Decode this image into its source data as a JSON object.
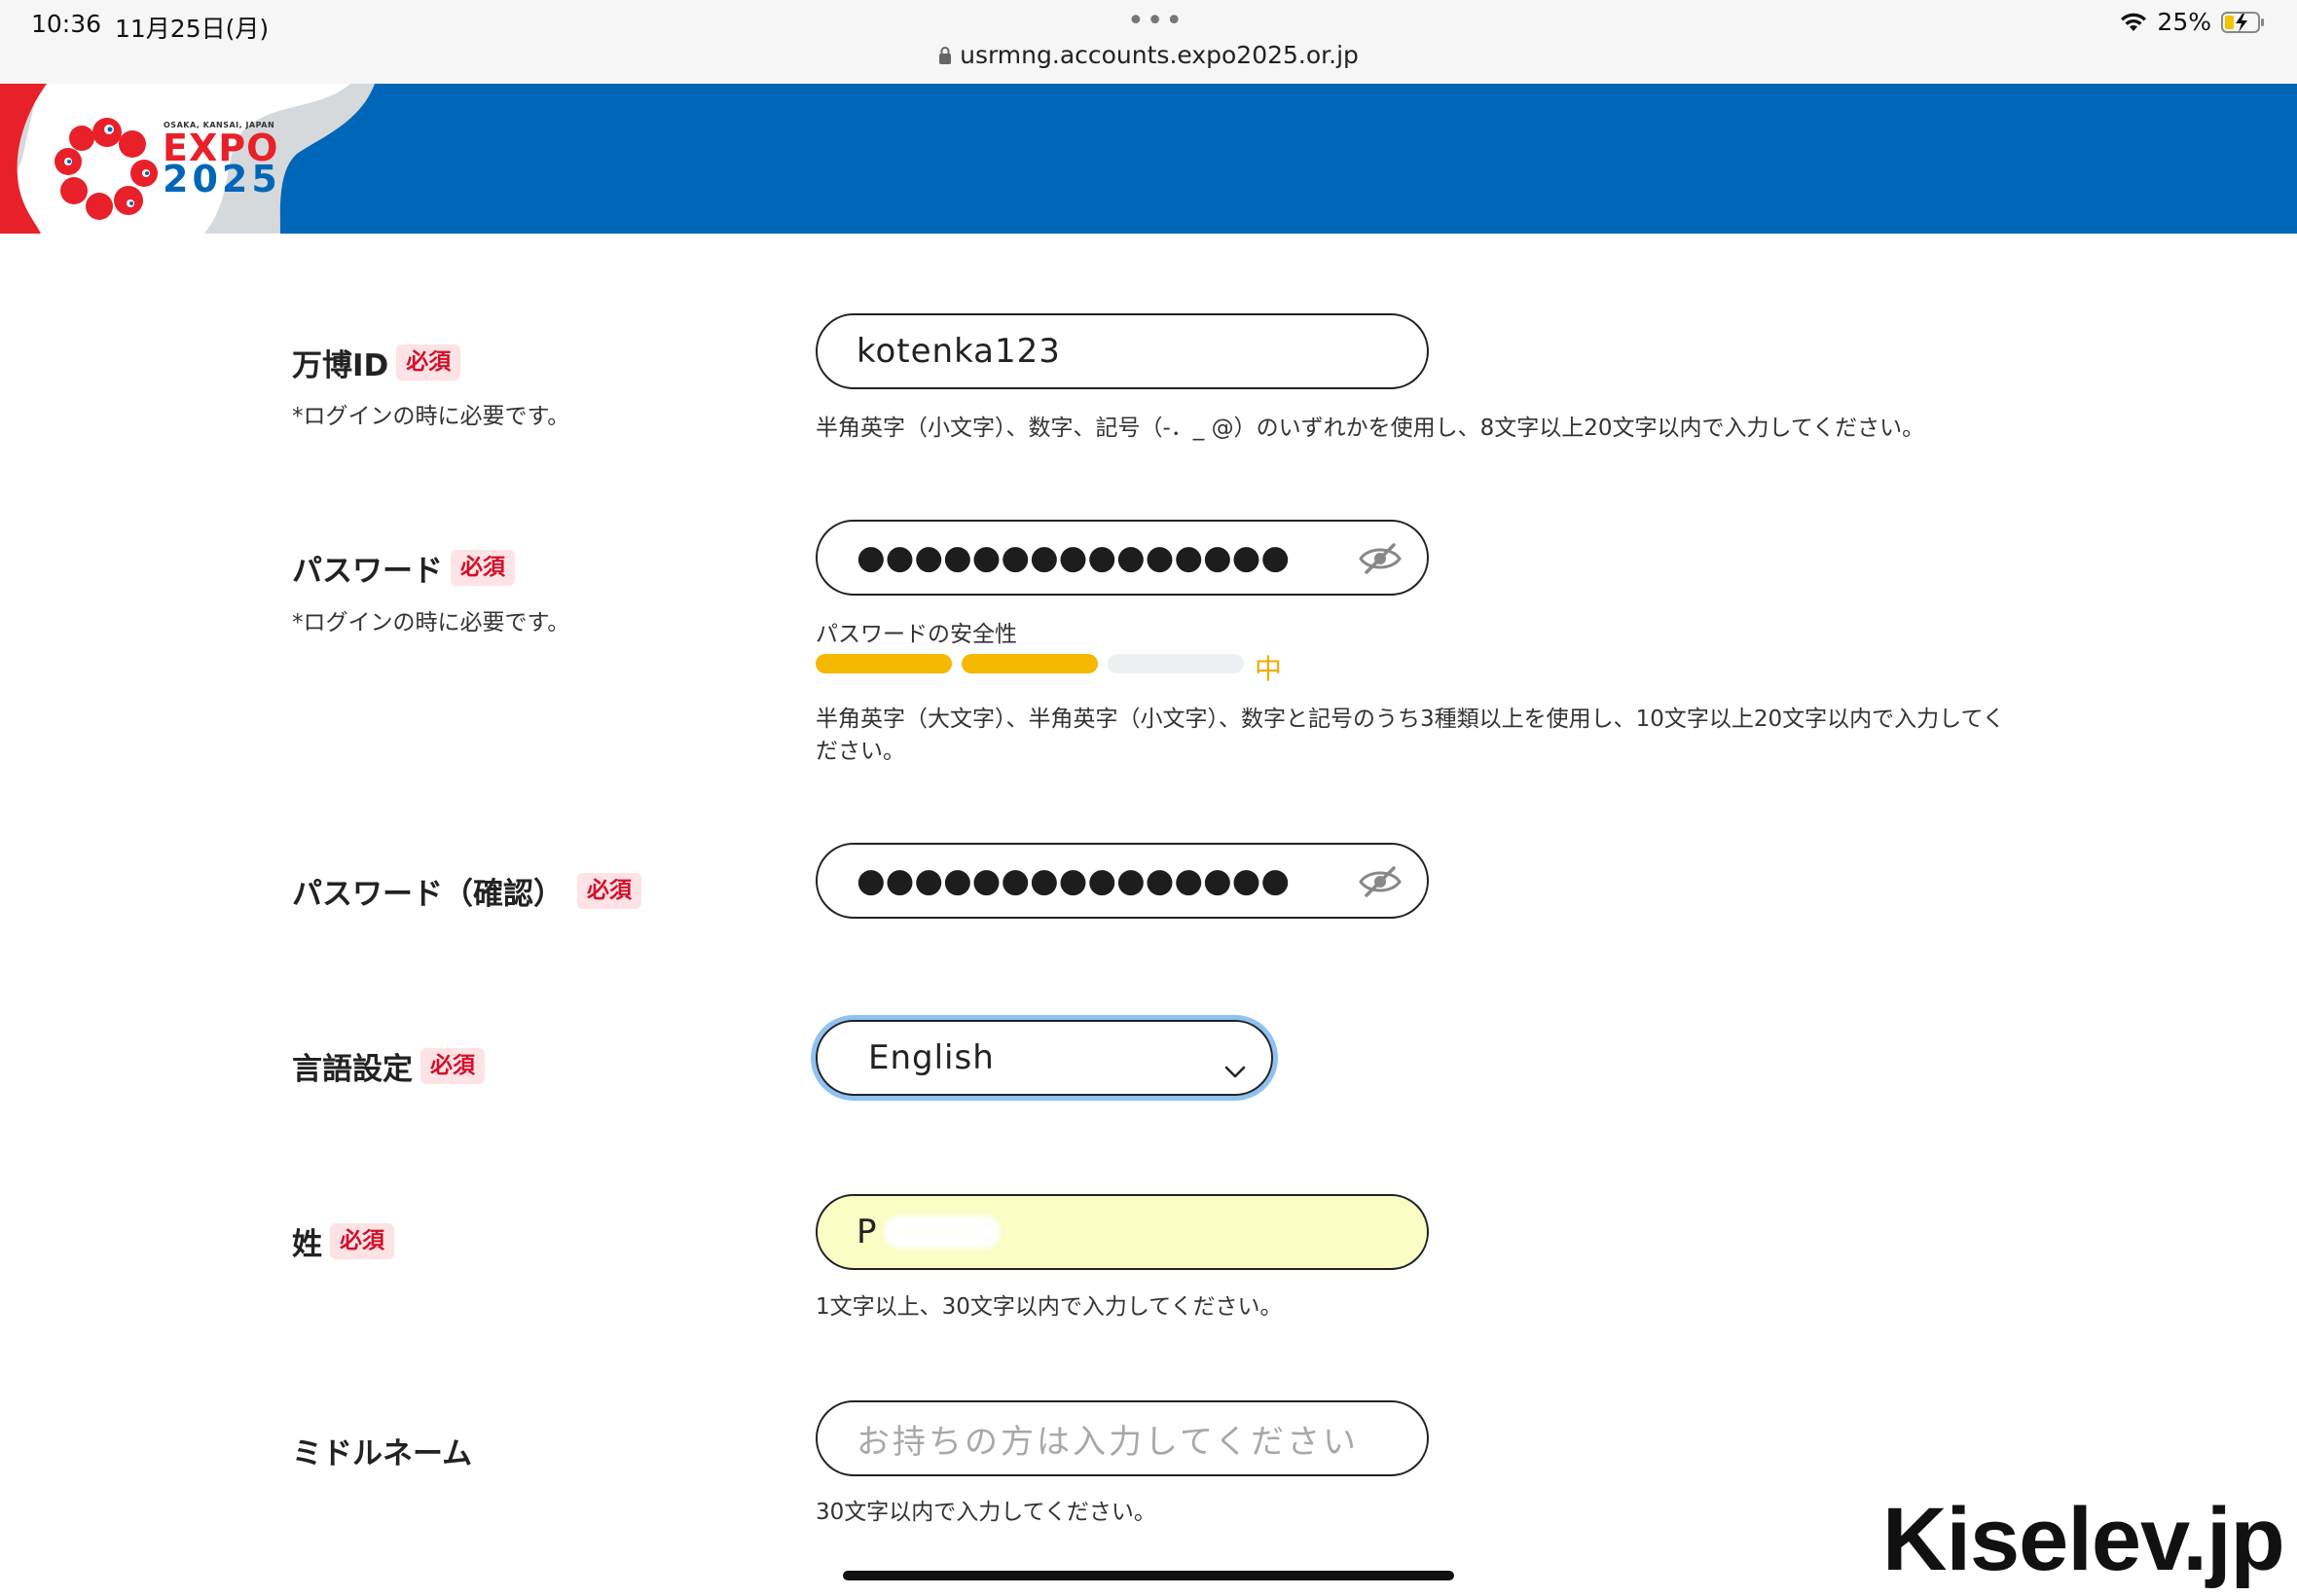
{
  "status_bar": {
    "time": "10:36",
    "date": "11月25日(月)",
    "battery_percent": "25%",
    "battery_level": 0.25,
    "icons": [
      "wifi-icon",
      "battery-charging-icon"
    ]
  },
  "browser": {
    "url": "usrmng.accounts.expo2025.or.jp",
    "menu_dots": "•••"
  },
  "header": {
    "logo_tagline": "OSAKA, KANSAI, JAPAN",
    "logo_line1": "EXPO",
    "logo_line2": "2025",
    "brand_blue": "#0066b8",
    "brand_red": "#e8202a"
  },
  "required_label": "必須",
  "form": {
    "expo_id": {
      "label": "万博ID",
      "sub": "*ログインの時に必要です。",
      "value": "kotenka123",
      "hint": "半角英字（小文字）、数字、記号（-．_ @）のいずれかを使用し、8文字以上20文字以内で入力してください。"
    },
    "password": {
      "label": "パスワード",
      "sub": "*ログインの時に必要です。",
      "masked_value": "●●●●●●●●●●●●●●●",
      "strength_title": "パスワードの安全性",
      "strength_level": 2,
      "strength_max": 3,
      "strength_text": "中",
      "strength_color": "#f5b700",
      "hint": "半角英字（大文字）、半角英字（小文字）、数字と記号のうち3種類以上を使用し、10文字以上20文字以内で入力してください。"
    },
    "password_confirm": {
      "label": "パスワード（確認）",
      "masked_value": "●●●●●●●●●●●●●●●"
    },
    "language": {
      "label": "言語設定",
      "selected": "English"
    },
    "last_name": {
      "label": "姓",
      "value": "P",
      "hint": "1文字以上、30文字以内で入力してください。"
    },
    "middle_name": {
      "label": "ミドルネーム",
      "placeholder": "お持ちの方は入力してください",
      "hint": "30文字以内で入力してください。"
    }
  },
  "watermark": "Kiselev.jp"
}
